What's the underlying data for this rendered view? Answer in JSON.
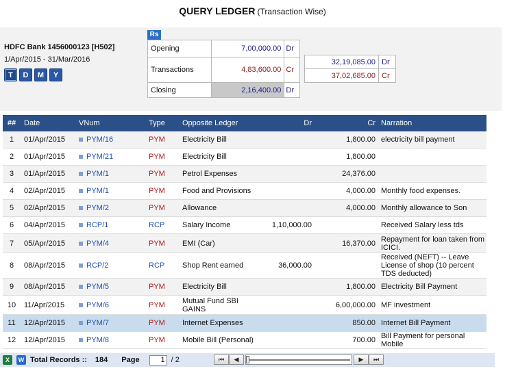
{
  "title": {
    "main": "QUERY LEDGER",
    "sub": "(Transaction Wise)"
  },
  "ledger": {
    "name": "HDFC Bank 1456000123 [H502]",
    "period": "1/Apr/2015  -  31/Mar/2016"
  },
  "period_buttons": [
    {
      "label": "T",
      "active": true
    },
    {
      "label": "D",
      "active": false
    },
    {
      "label": "M",
      "active": false
    },
    {
      "label": "Y",
      "active": false
    }
  ],
  "currency_badge": "Rs",
  "balances": {
    "opening": {
      "label": "Opening",
      "amount": "7,00,000.00",
      "dc": "Dr"
    },
    "transactions": {
      "label": "Transactions",
      "amount": "4,83,600.00",
      "dc": "Cr"
    },
    "closing": {
      "label": "Closing",
      "amount": "2,16,400.00",
      "dc": "Dr"
    }
  },
  "transaction_totals": [
    {
      "amount": "32,19,085.00",
      "dc": "Dr"
    },
    {
      "amount": "37,02,685.00",
      "dc": "Cr"
    }
  ],
  "grid": {
    "headers": {
      "no": "##",
      "date": "Date",
      "vnum": "VNum",
      "type": "Type",
      "opposite": "Opposite Ledger",
      "dr": "Dr",
      "cr": "Cr",
      "narration": "Narration"
    },
    "rows": [
      {
        "no": "1",
        "date": "01/Apr/2015",
        "vnum": "PYM/16",
        "type": "PYM",
        "opposite": "Electricity Bill",
        "dr": "",
        "cr": "1,800.00",
        "narration": "electricity bill payment"
      },
      {
        "no": "2",
        "date": "01/Apr/2015",
        "vnum": "PYM/21",
        "type": "PYM",
        "opposite": "Electricity Bill",
        "dr": "",
        "cr": "1,800.00",
        "narration": ""
      },
      {
        "no": "3",
        "date": "01/Apr/2015",
        "vnum": "PYM/1",
        "type": "PYM",
        "opposite": "Petrol Expenses",
        "dr": "",
        "cr": "24,376.00",
        "narration": ""
      },
      {
        "no": "4",
        "date": "02/Apr/2015",
        "vnum": "PYM/1",
        "type": "PYM",
        "opposite": "Food and Provisions",
        "dr": "",
        "cr": "4,000.00",
        "narration": "Monthly food expenses."
      },
      {
        "no": "5",
        "date": "02/Apr/2015",
        "vnum": "PYM/2",
        "type": "PYM",
        "opposite": "Allowance",
        "dr": "",
        "cr": "4,000.00",
        "narration": "Monthly allowance to Son"
      },
      {
        "no": "6",
        "date": "04/Apr/2015",
        "vnum": "RCP/1",
        "type": "RCP",
        "opposite": "Salary Income",
        "dr": "1,10,000.00",
        "cr": "",
        "narration": "Received Salary less tds"
      },
      {
        "no": "7",
        "date": "05/Apr/2015",
        "vnum": "PYM/4",
        "type": "PYM",
        "opposite": "EMI (Car)",
        "dr": "",
        "cr": "16,370.00",
        "narration": "Repayment for loan taken from ICICI."
      },
      {
        "no": "8",
        "date": "08/Apr/2015",
        "vnum": "RCP/2",
        "type": "RCP",
        "opposite": "Shop Rent earned",
        "dr": "36,000.00",
        "cr": "",
        "narration": "Received (NEFT) -- Leave License of shop (10 percent TDS deducted)"
      },
      {
        "no": "9",
        "date": "08/Apr/2015",
        "vnum": "PYM/5",
        "type": "PYM",
        "opposite": "Electricity Bill",
        "dr": "",
        "cr": "1,800.00",
        "narration": "Electricity Bill Payment"
      },
      {
        "no": "10",
        "date": "11/Apr/2015",
        "vnum": "PYM/6",
        "type": "PYM",
        "opposite": "Mutual Fund SBI GAINS",
        "dr": "",
        "cr": "6,00,000.00",
        "narration": "MF investment"
      },
      {
        "no": "11",
        "date": "12/Apr/2015",
        "vnum": "PYM/7",
        "type": "PYM",
        "opposite": "Internet Expenses",
        "dr": "",
        "cr": "850.00",
        "narration": "Internet Bill Payment"
      },
      {
        "no": "12",
        "date": "12/Apr/2015",
        "vnum": "PYM/8",
        "type": "PYM",
        "opposite": "Mobile Bill (Personal)",
        "dr": "",
        "cr": "700.00",
        "narration": "Bill Payment for personal Mobile"
      }
    ]
  },
  "footer": {
    "excel_icon": "excel-export-icon",
    "word_icon": "word-export-icon",
    "total_label": "Total Records ::",
    "total_count": "184",
    "page_label": "Page",
    "page_value": "1",
    "page_total": "/  2",
    "nav": {
      "first": "⏮",
      "prev": "◀",
      "next": "▶",
      "last": "⏭"
    }
  },
  "colors": {
    "header_bg": "#2b4f87",
    "selected_row": "#c9dcee",
    "dr": "#1a1a8c",
    "cr": "#8b1a1a",
    "pym": "#b01818",
    "rcp": "#1f4fb0"
  }
}
